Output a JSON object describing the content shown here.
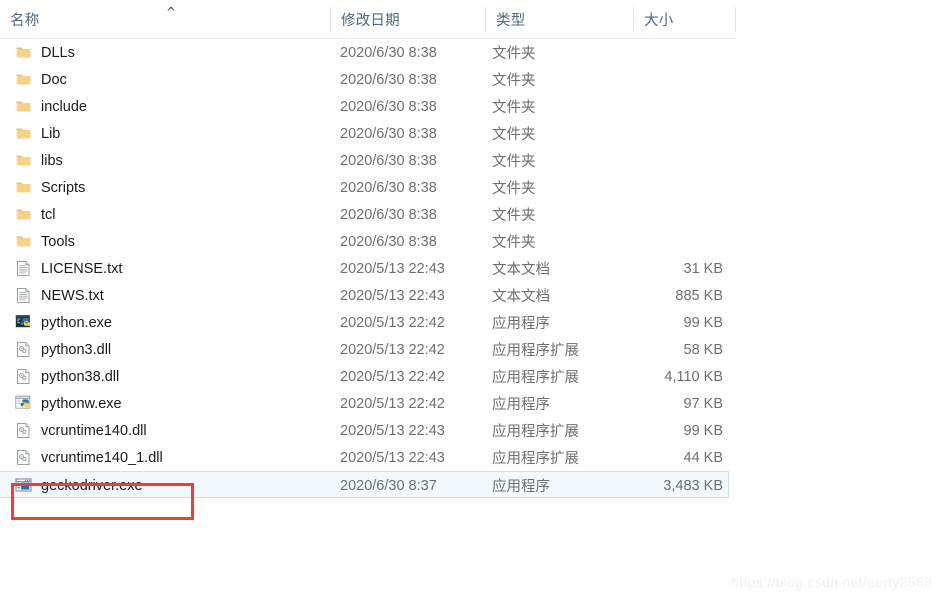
{
  "columns": {
    "name": "名称",
    "date_modified": "修改日期",
    "type": "类型",
    "size": "大小",
    "sort_indicator": "^"
  },
  "rows": [
    {
      "icon": "folder-icon",
      "name": "DLLs",
      "date": "2020/6/30 8:38",
      "type": "文件夹",
      "size": ""
    },
    {
      "icon": "folder-icon",
      "name": "Doc",
      "date": "2020/6/30 8:38",
      "type": "文件夹",
      "size": ""
    },
    {
      "icon": "folder-icon",
      "name": "include",
      "date": "2020/6/30 8:38",
      "type": "文件夹",
      "size": ""
    },
    {
      "icon": "folder-icon",
      "name": "Lib",
      "date": "2020/6/30 8:38",
      "type": "文件夹",
      "size": ""
    },
    {
      "icon": "folder-icon",
      "name": "libs",
      "date": "2020/6/30 8:38",
      "type": "文件夹",
      "size": ""
    },
    {
      "icon": "folder-icon",
      "name": "Scripts",
      "date": "2020/6/30 8:38",
      "type": "文件夹",
      "size": ""
    },
    {
      "icon": "folder-icon",
      "name": "tcl",
      "date": "2020/6/30 8:38",
      "type": "文件夹",
      "size": ""
    },
    {
      "icon": "folder-icon",
      "name": "Tools",
      "date": "2020/6/30 8:38",
      "type": "文件夹",
      "size": ""
    },
    {
      "icon": "text-file-icon",
      "name": "LICENSE.txt",
      "date": "2020/5/13 22:43",
      "type": "文本文档",
      "size": "31 KB"
    },
    {
      "icon": "text-file-icon",
      "name": "NEWS.txt",
      "date": "2020/5/13 22:43",
      "type": "文本文档",
      "size": "885 KB"
    },
    {
      "icon": "python-exe-icon",
      "name": "python.exe",
      "date": "2020/5/13 22:42",
      "type": "应用程序",
      "size": "99 KB"
    },
    {
      "icon": "dll-file-icon",
      "name": "python3.dll",
      "date": "2020/5/13 22:42",
      "type": "应用程序扩展",
      "size": "58 KB"
    },
    {
      "icon": "dll-file-icon",
      "name": "python38.dll",
      "date": "2020/5/13 22:42",
      "type": "应用程序扩展",
      "size": "4,110 KB"
    },
    {
      "icon": "pythonw-exe-icon",
      "name": "pythonw.exe",
      "date": "2020/5/13 22:42",
      "type": "应用程序",
      "size": "97 KB"
    },
    {
      "icon": "dll-file-icon",
      "name": "vcruntime140.dll",
      "date": "2020/5/13 22:43",
      "type": "应用程序扩展",
      "size": "99 KB"
    },
    {
      "icon": "dll-file-icon",
      "name": "vcruntime140_1.dll",
      "date": "2020/5/13 22:43",
      "type": "应用程序扩展",
      "size": "44 KB"
    },
    {
      "icon": "app-exe-icon",
      "name": "geckodriver.exe",
      "date": "2020/6/30 8:37",
      "type": "应用程序",
      "size": "3,483 KB",
      "selected": true,
      "annotated": true
    }
  ],
  "annotation": {
    "shape": "rectangle",
    "color": "#ef3e36",
    "target": "geckodriver.exe"
  },
  "watermark": {
    "text": "https://blog.csdn.net/eerty2588",
    "color": "#f0f0f0"
  },
  "colors": {
    "header_text": "#4f6a7d",
    "row_text": "#1b1b1b",
    "meta_text": "#6f6f6f",
    "selection_bg": "#f2f8fd",
    "selection_border": "#cce2f2",
    "folder_yellow": "#f7d178",
    "annotation_red": "#ef3e36"
  }
}
